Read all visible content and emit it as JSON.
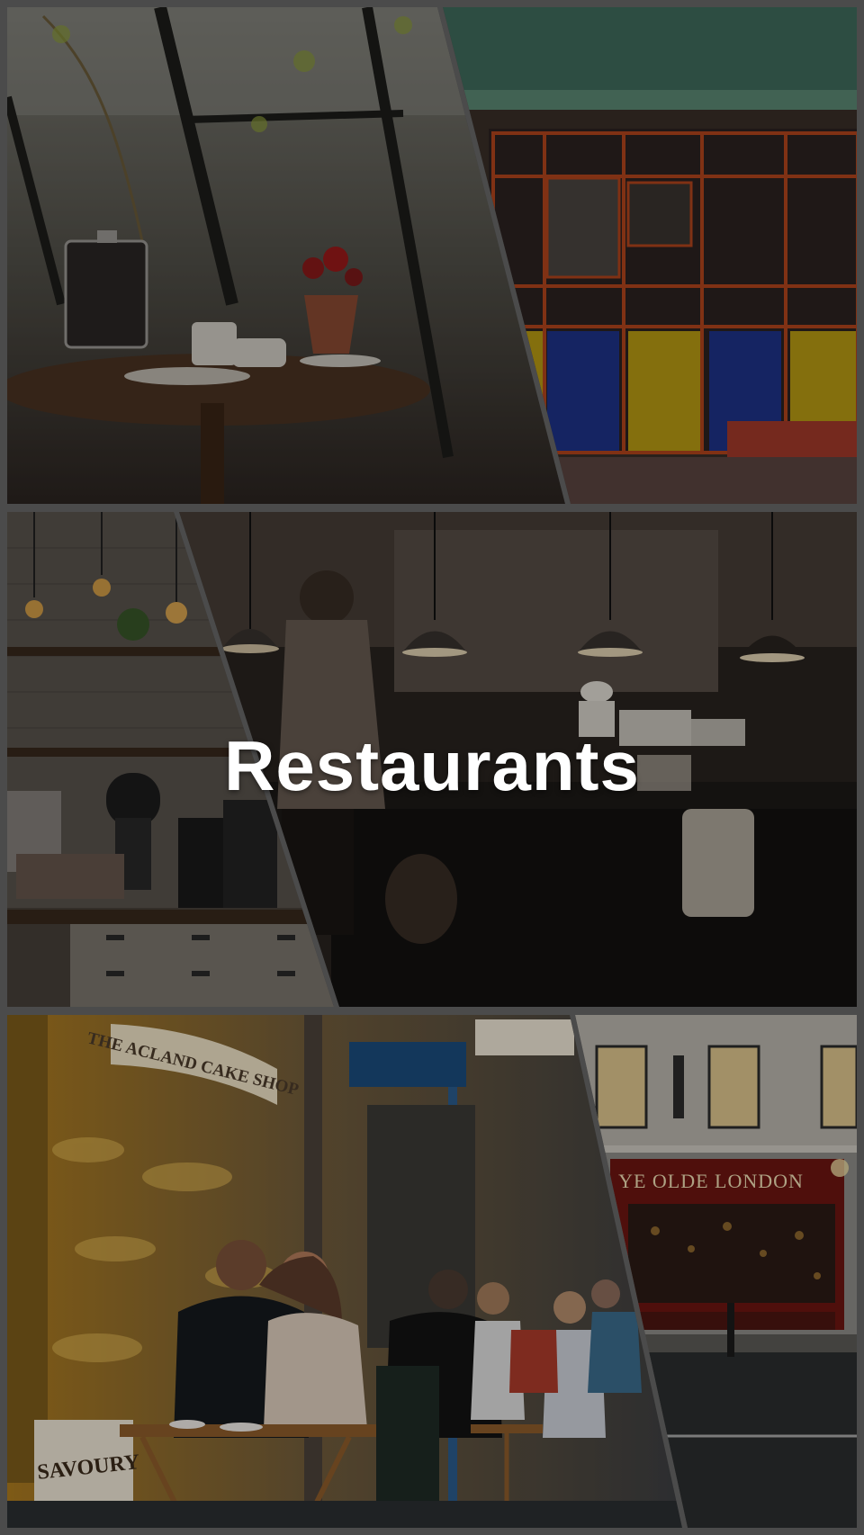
{
  "title": "Restaurants",
  "photos": [
    {
      "name": "cafe-window-table"
    },
    {
      "name": "colorful-shopfront"
    },
    {
      "name": "coffee-bar-counter"
    },
    {
      "name": "restaurant-kitchen"
    },
    {
      "name": "cake-shop-outdoor-dining",
      "signs": [
        "THE ACLAND CAKE SHOP",
        "SAVOURY"
      ]
    },
    {
      "name": "london-pub-street",
      "signs": [
        "YE OLDE LONDON"
      ]
    }
  ],
  "colors": {
    "background": "#4b4b4b",
    "title": "#ffffff"
  }
}
